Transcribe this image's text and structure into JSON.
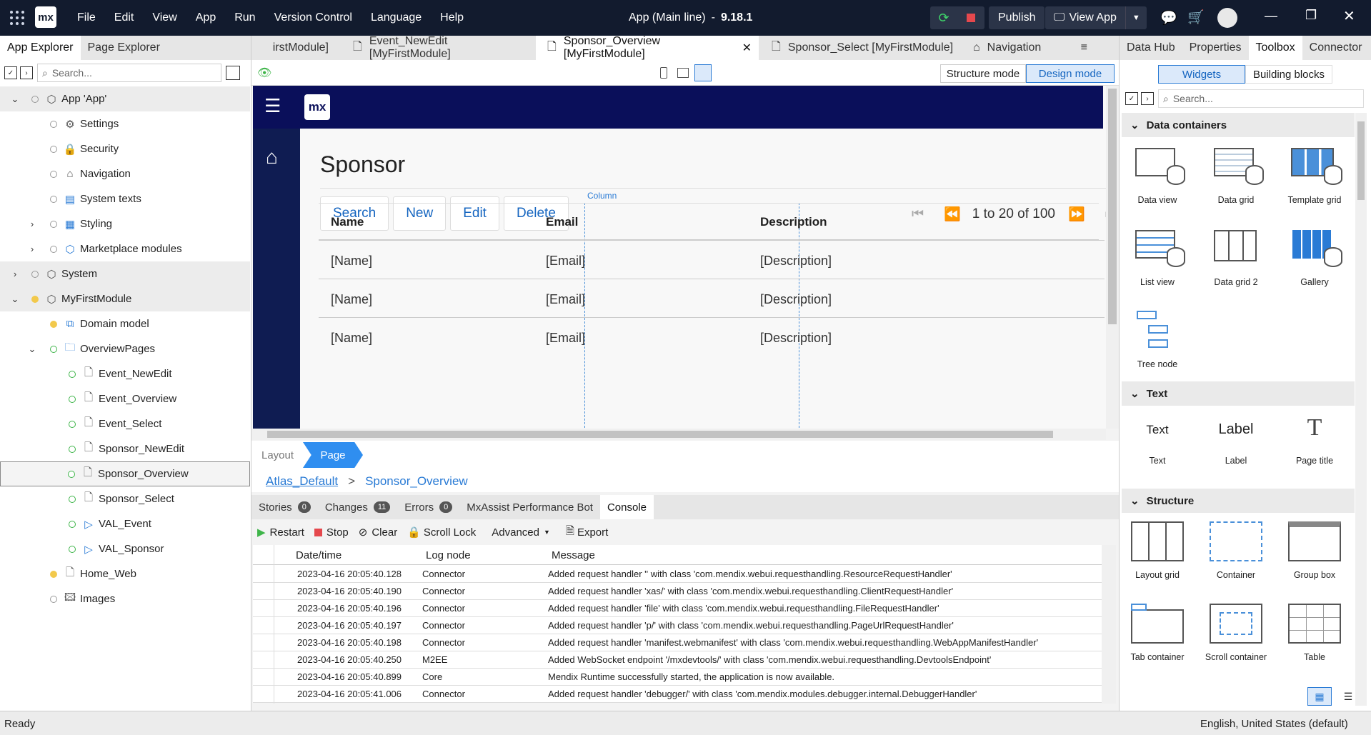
{
  "menu": [
    "File",
    "Edit",
    "View",
    "App",
    "Run",
    "Version Control",
    "Language",
    "Help"
  ],
  "app_title": "App (Main line)",
  "app_version": "9.18.1",
  "publish_label": "Publish",
  "viewapp_label": "View App",
  "left_tabs": [
    "App Explorer",
    "Page Explorer"
  ],
  "left_search_placeholder": "Search...",
  "tree": [
    "App 'App'",
    "Settings",
    "Security",
    "Navigation",
    "System texts",
    "Styling",
    "Marketplace modules",
    "System",
    "MyFirstModule",
    "Domain model",
    "OverviewPages",
    "Event_NewEdit",
    "Event_Overview",
    "Event_Select",
    "Sponsor_NewEdit",
    "Sponsor_Overview",
    "Sponsor_Select",
    "VAL_Event",
    "VAL_Sponsor",
    "Home_Web",
    "Images"
  ],
  "doc_tabs": [
    "irstModule]",
    "Event_NewEdit [MyFirstModule]",
    "Sponsor_Overview [MyFirstModule]",
    "Sponsor_Select [MyFirstModule]",
    "Navigation"
  ],
  "mode": {
    "structure": "Structure mode",
    "design": "Design mode"
  },
  "canvas": {
    "logo": "mx",
    "page_title": "Sponsor",
    "buttons": [
      "Search",
      "New",
      "Edit",
      "Delete"
    ],
    "paging": "1 to 20 of 100",
    "column_label": "Column",
    "headers": [
      "Name",
      "Email",
      "Description"
    ],
    "rows": [
      [
        "[Name]",
        "[Email]",
        "[Description]"
      ],
      [
        "[Name]",
        "[Email]",
        "[Description]"
      ],
      [
        "[Name]",
        "[Email]",
        "[Description]"
      ]
    ]
  },
  "layout_tabs": [
    "Layout",
    "Page"
  ],
  "breadcrumb": [
    "Atlas_Default",
    ">",
    "Sponsor_Overview"
  ],
  "bottom_tabs": [
    {
      "label": "Stories",
      "count": "0"
    },
    {
      "label": "Changes",
      "count": "11"
    },
    {
      "label": "Errors",
      "count": "0"
    },
    {
      "label": "MxAssist Performance Bot",
      "count": ""
    },
    {
      "label": "Console",
      "count": ""
    }
  ],
  "console_toolbar": [
    "Restart",
    "Stop",
    "Clear",
    "Scroll Lock",
    "Advanced",
    "Export"
  ],
  "console_headers": [
    "Date/time",
    "Log node",
    "Message"
  ],
  "console_rows": [
    [
      "2023-04-16 20:05:40.128",
      "Connector",
      "Added request handler '' with class 'com.mendix.webui.requesthandling.ResourceRequestHandler'"
    ],
    [
      "2023-04-16 20:05:40.190",
      "Connector",
      "Added request handler 'xas/' with class 'com.mendix.webui.requesthandling.ClientRequestHandler'"
    ],
    [
      "2023-04-16 20:05:40.196",
      "Connector",
      "Added request handler 'file' with class 'com.mendix.webui.requesthandling.FileRequestHandler'"
    ],
    [
      "2023-04-16 20:05:40.197",
      "Connector",
      "Added request handler 'p/' with class 'com.mendix.webui.requesthandling.PageUrlRequestHandler'"
    ],
    [
      "2023-04-16 20:05:40.198",
      "Connector",
      "Added request handler 'manifest.webmanifest' with class 'com.mendix.webui.requesthandling.WebAppManifestHandler'"
    ],
    [
      "2023-04-16 20:05:40.250",
      "M2EE",
      "Added WebSocket endpoint '/mxdevtools/' with class 'com.mendix.webui.requesthandling.DevtoolsEndpoint'"
    ],
    [
      "2023-04-16 20:05:40.899",
      "Core",
      "Mendix Runtime successfully started, the application is now available."
    ],
    [
      "2023-04-16 20:05:41.006",
      "Connector",
      "Added request handler 'debugger/' with class 'com.mendix.modules.debugger.internal.DebuggerHandler'"
    ]
  ],
  "right_tabs": [
    "Data Hub",
    "Properties",
    "Toolbox",
    "Connector"
  ],
  "toolbox_toggle": [
    "Widgets",
    "Building blocks"
  ],
  "toolbox_search_placeholder": "Search...",
  "sections": {
    "data": "Data containers",
    "text": "Text",
    "structure": "Structure"
  },
  "tools_data": [
    "Data view",
    "Data grid",
    "Template grid",
    "List view",
    "Data grid 2",
    "Gallery",
    "Tree node"
  ],
  "tools_text": [
    "Text",
    "Label",
    "Page title"
  ],
  "text_samples": [
    "Text",
    "Label"
  ],
  "tools_structure": [
    "Layout grid",
    "Container",
    "Group box",
    "Tab container",
    "Scroll container",
    "Table"
  ],
  "status": {
    "left": "Ready",
    "right": "English, United States (default)"
  }
}
